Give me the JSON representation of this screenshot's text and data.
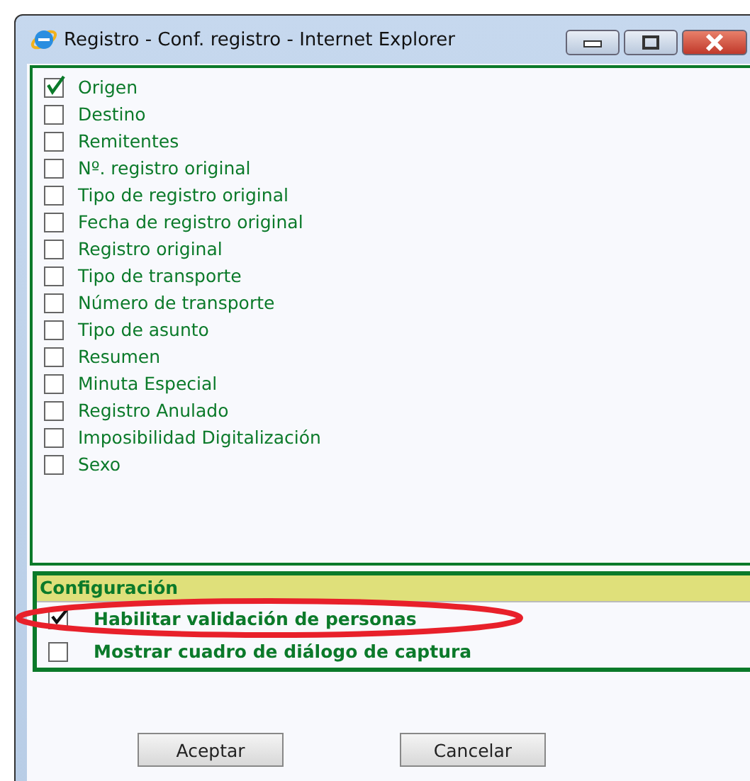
{
  "window": {
    "title": "Registro - Conf. registro - Internet Explorer"
  },
  "fields": [
    {
      "label": "Origen",
      "checked": true
    },
    {
      "label": "Destino",
      "checked": false
    },
    {
      "label": "Remitentes",
      "checked": false
    },
    {
      "label": "Nº. registro original",
      "checked": false
    },
    {
      "label": "Tipo de registro original",
      "checked": false
    },
    {
      "label": "Fecha de registro original",
      "checked": false
    },
    {
      "label": "Registro original",
      "checked": false
    },
    {
      "label": "Tipo de transporte",
      "checked": false
    },
    {
      "label": "Número de transporte",
      "checked": false
    },
    {
      "label": "Tipo de asunto",
      "checked": false
    },
    {
      "label": "Resumen",
      "checked": false
    },
    {
      "label": "Minuta Especial",
      "checked": false
    },
    {
      "label": "Registro Anulado",
      "checked": false
    },
    {
      "label": "Imposibilidad Digitalización",
      "checked": false
    },
    {
      "label": "Sexo",
      "checked": false
    }
  ],
  "configuration": {
    "title": "Configuración",
    "options": [
      {
        "label": "Habilitar validación de personas",
        "checked": true
      },
      {
        "label": "Mostrar cuadro de diálogo de captura",
        "checked": false
      }
    ]
  },
  "buttons": [
    "Aceptar",
    "Cancelar"
  ]
}
